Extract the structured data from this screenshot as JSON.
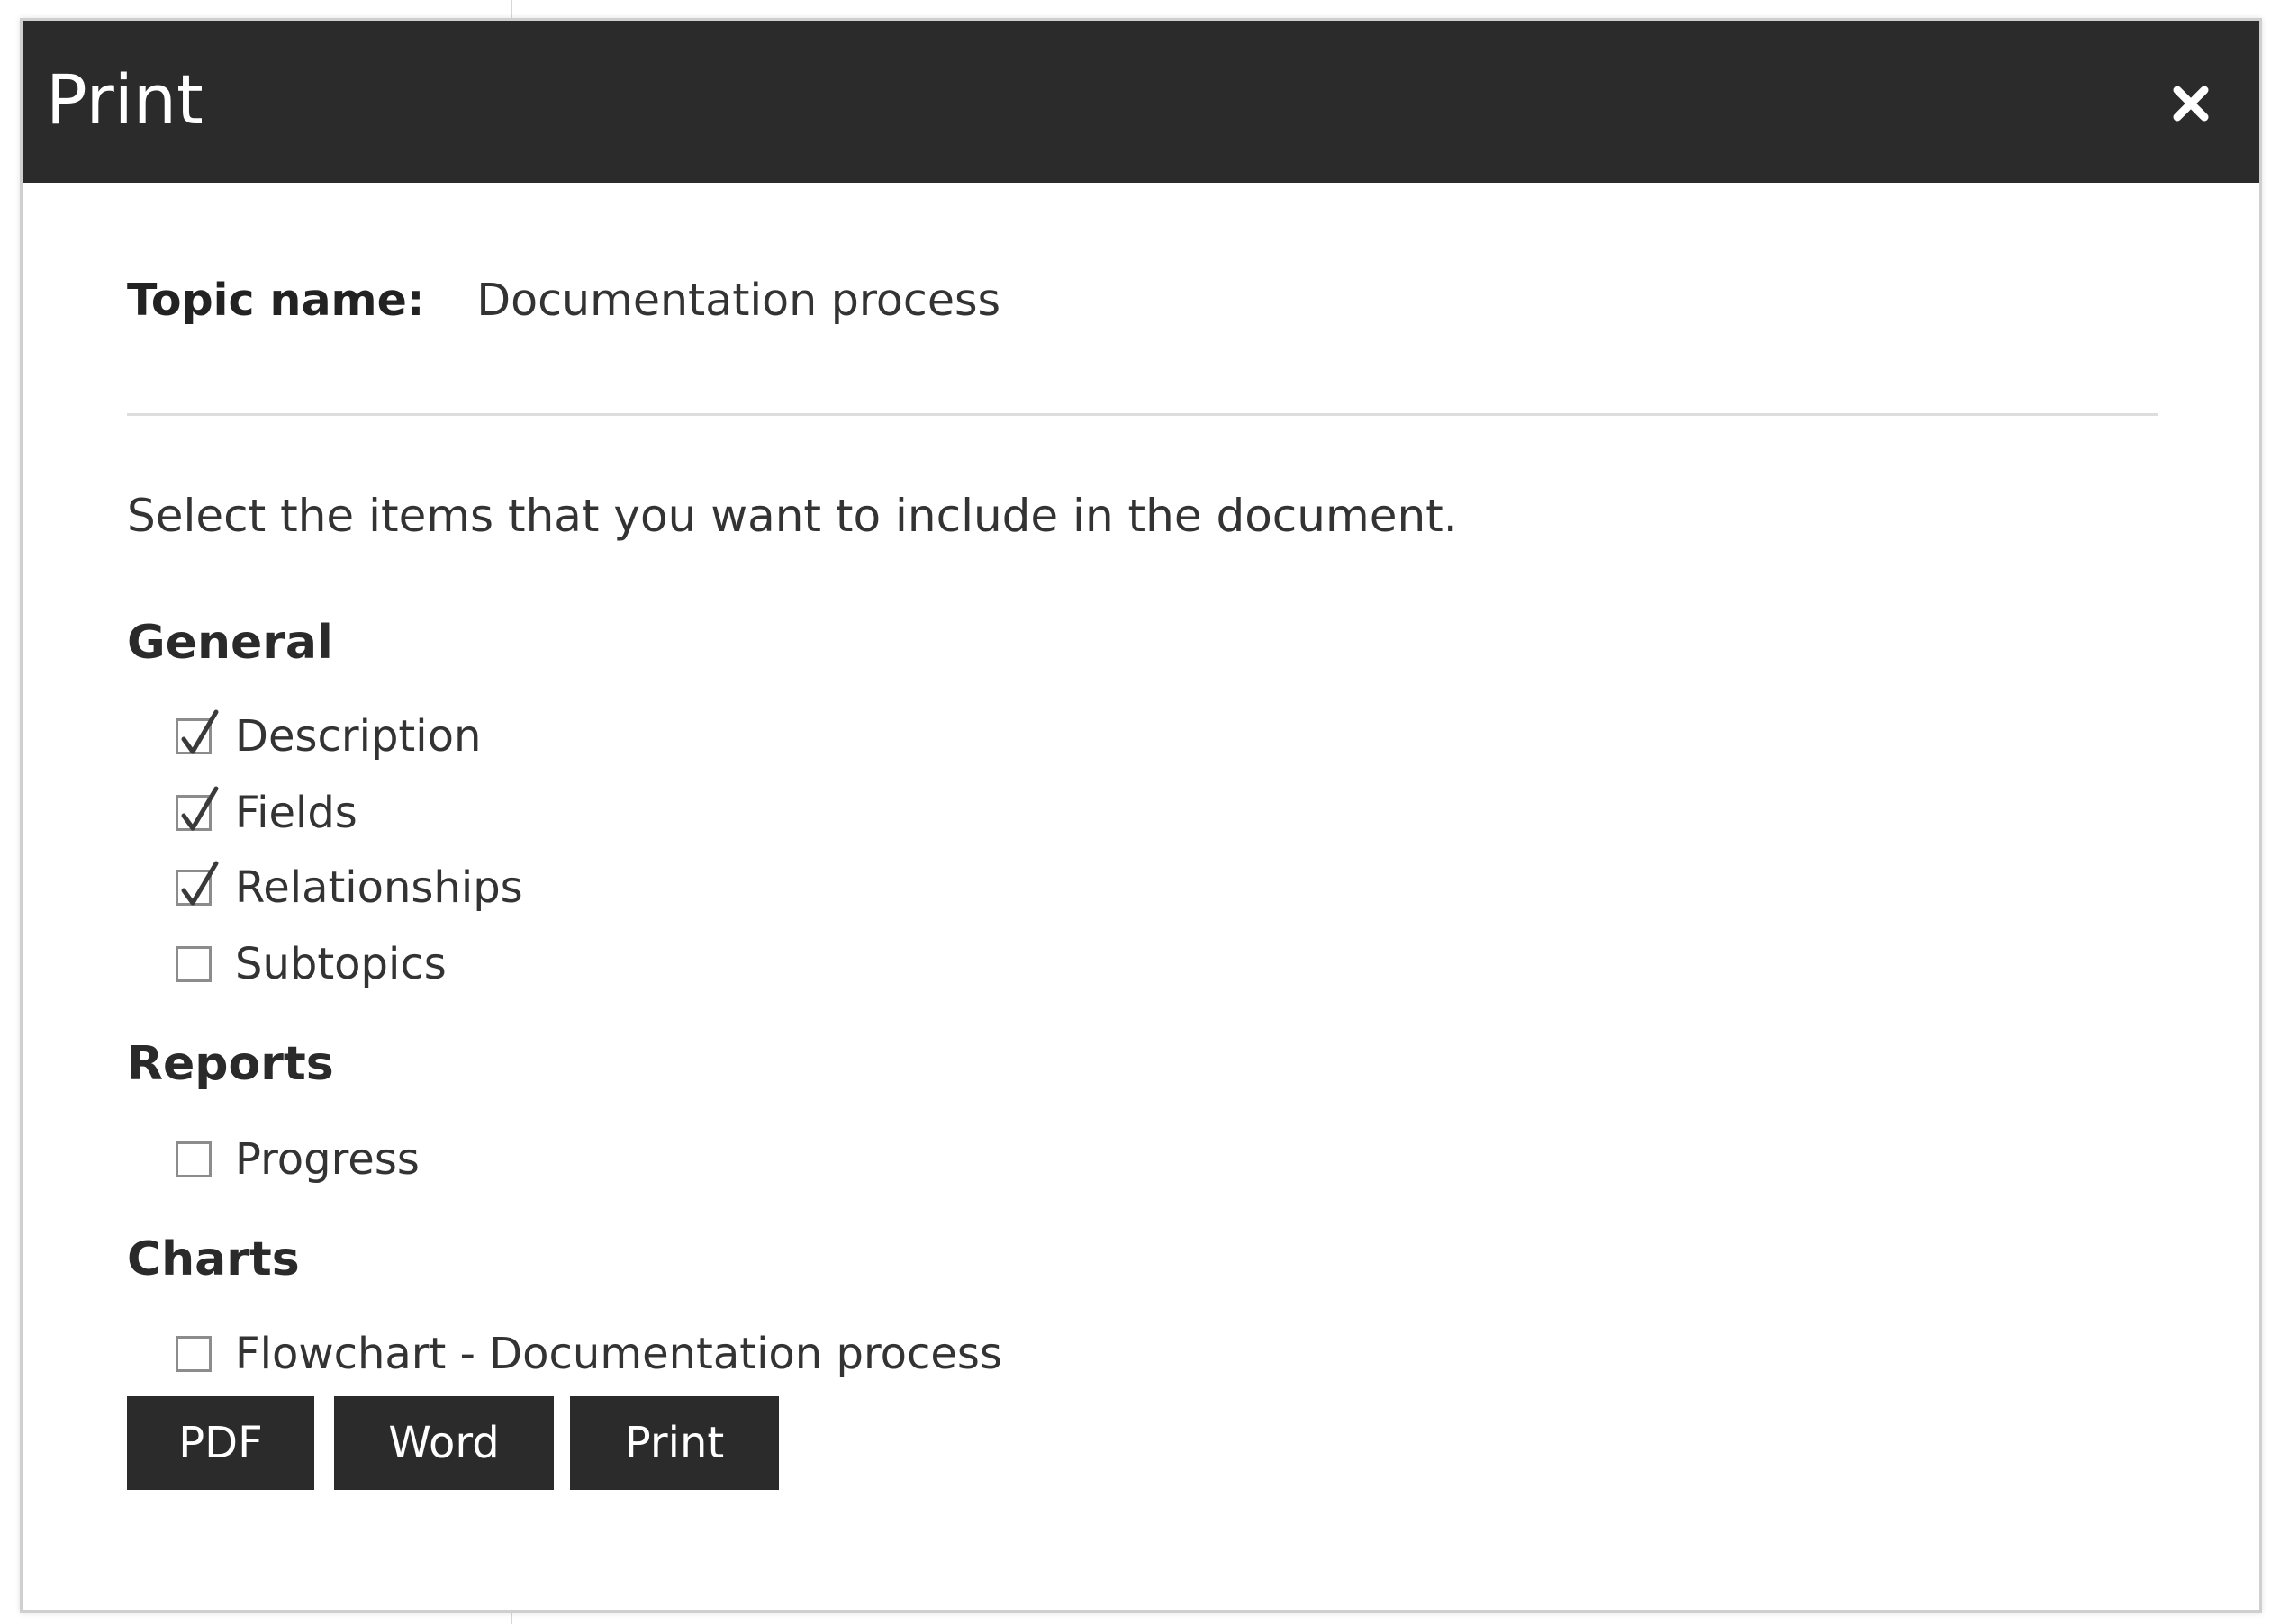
{
  "dialog": {
    "title": "Print",
    "close_icon": "close-icon"
  },
  "topic": {
    "label": "Topic name:",
    "value": "Documentation process"
  },
  "instruction": "Select the items that you want to include in the document.",
  "sections": {
    "general": {
      "heading": "General",
      "items": [
        {
          "label": "Description",
          "checked": true
        },
        {
          "label": "Fields",
          "checked": true
        },
        {
          "label": "Relationships",
          "checked": true
        },
        {
          "label": "Subtopics",
          "checked": false
        }
      ]
    },
    "reports": {
      "heading": "Reports",
      "items": [
        {
          "label": "Progress",
          "checked": false
        }
      ]
    },
    "charts": {
      "heading": "Charts",
      "items": [
        {
          "label": "Flowchart - Documentation process",
          "checked": false
        }
      ]
    }
  },
  "buttons": {
    "pdf": "PDF",
    "word": "Word",
    "print": "Print"
  },
  "colors": {
    "titlebar": "#2b2b2b",
    "button": "#2b2b2b",
    "checkbox_border": "#8c8c8c"
  }
}
